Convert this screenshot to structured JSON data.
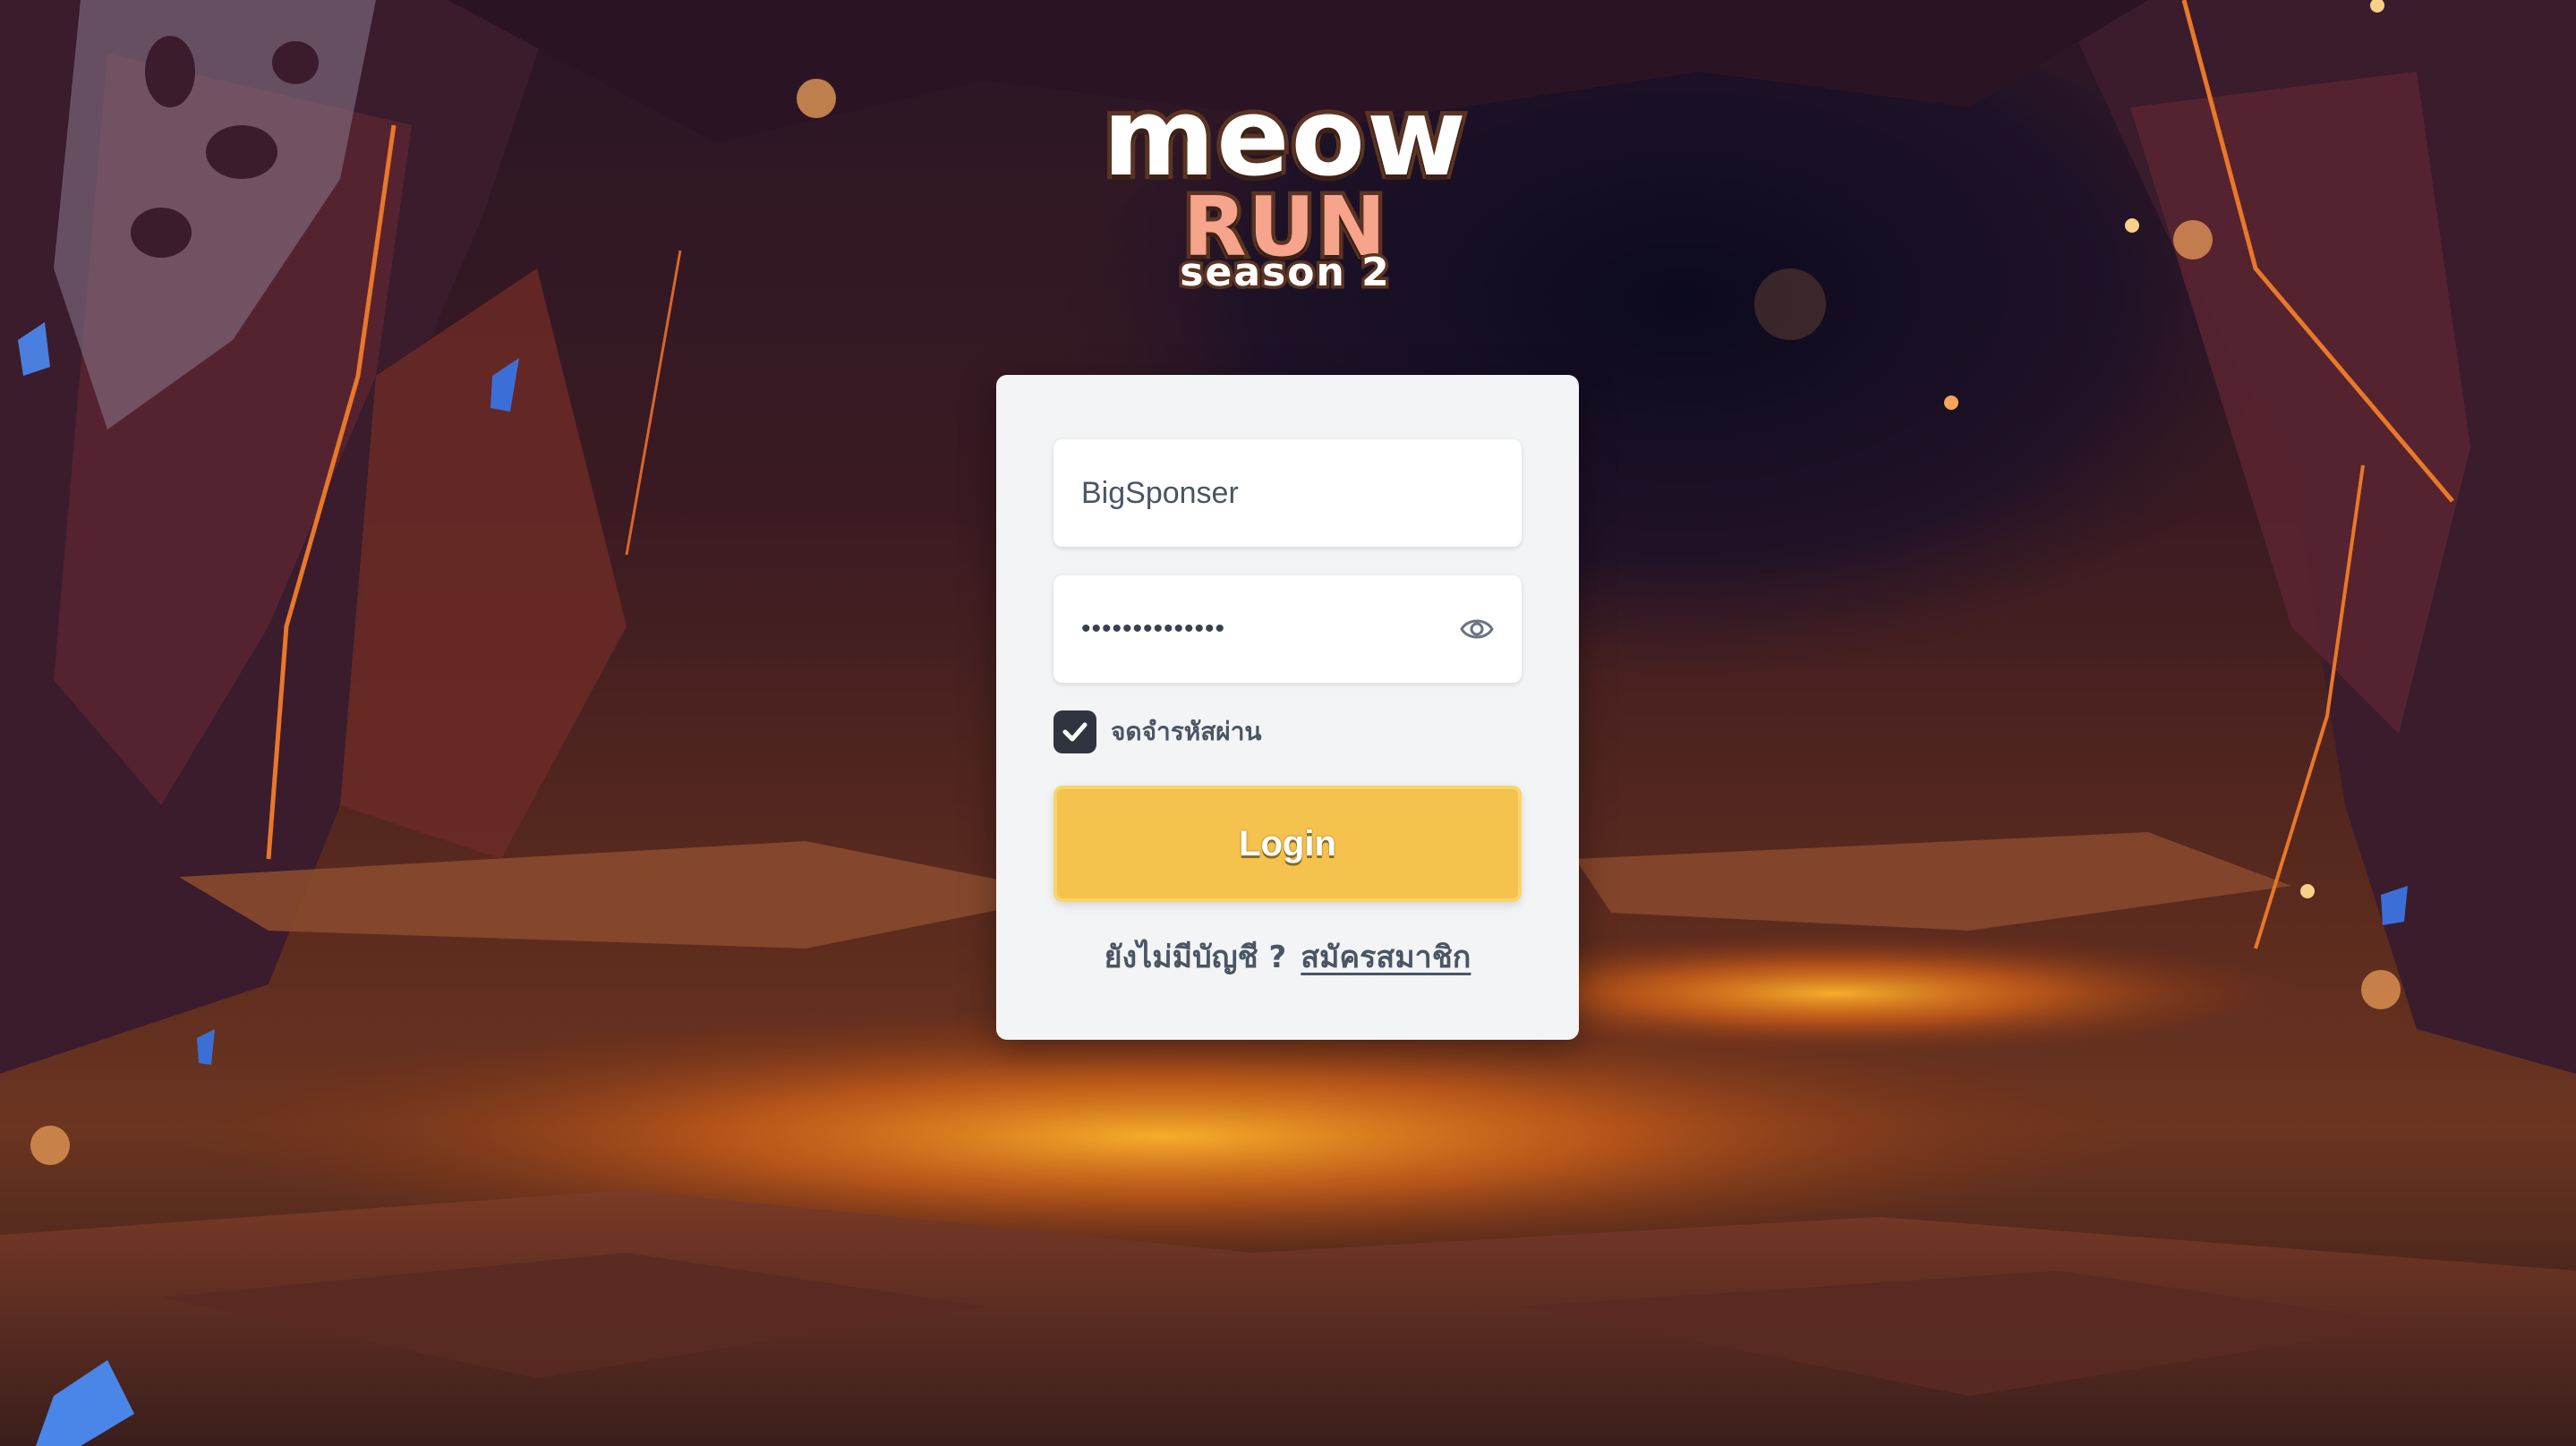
{
  "logo": {
    "line1": "meow",
    "line2": "RUN",
    "line3": "season 2"
  },
  "login_form": {
    "username_value": "BigSponser",
    "password_value": "••••••••••••••",
    "show_password_icon": "eye-icon",
    "remember_checked": true,
    "remember_label": "จดจำรหัสผ่าน",
    "login_label": "Login",
    "signup_prompt": "ยังไม่มีบัญชี ?",
    "signup_link": "สมัครสมาชิก"
  },
  "colors": {
    "card_bg": "#f3f4f6",
    "button": "#f4c24d",
    "checkbox": "#2f3440",
    "logo_outline": "#5a3322",
    "logo_run": "#f6a48b"
  }
}
